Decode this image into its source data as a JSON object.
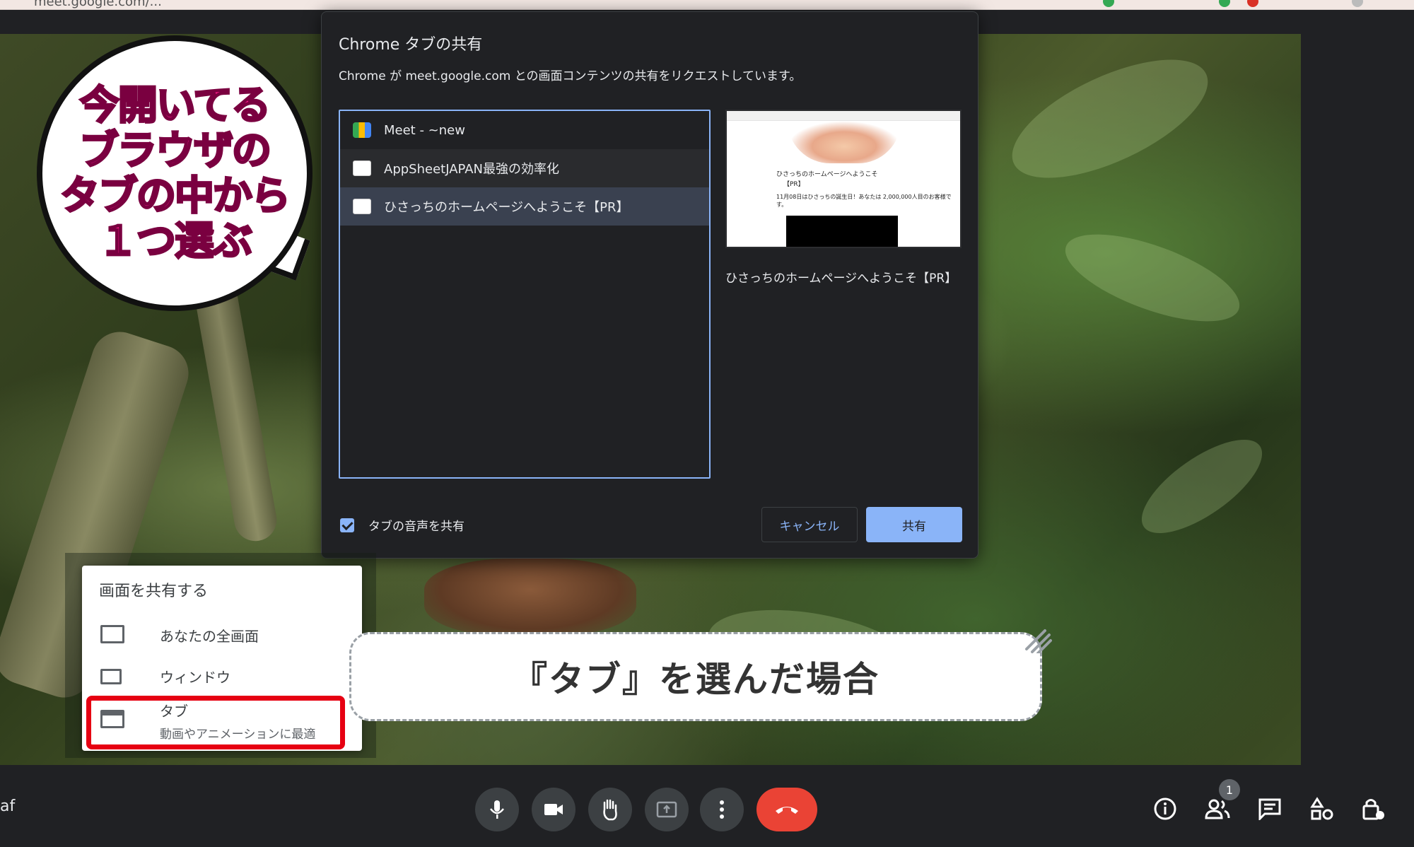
{
  "browser": {
    "url": "meet.google.com/..."
  },
  "bubble": {
    "line1": "今開いてる",
    "line2": "ブラウザの",
    "line3": "タブの中から",
    "line4": "１つ選ぶ"
  },
  "dialog": {
    "title": "Chrome タブの共有",
    "subtitle": "Chrome が meet.google.com との画面コンテンツの共有をリクエストしています。",
    "tabs": [
      {
        "label": "Meet - ~new",
        "icon": "meet-icon"
      },
      {
        "label": "AppSheetJAPAN最強の効率化",
        "icon": "page-favicon"
      },
      {
        "label": "ひさっちのホームページへようこそ【PR】",
        "icon": "page-favicon"
      }
    ],
    "selected_index": 2,
    "preview": {
      "line1": "ひさっちのホームページへようこそ",
      "line2": "【PR】",
      "line3": "11月08日はひさっちの誕生日！あなたは 2,000,000人目のお客様です。"
    },
    "preview_caption": "ひさっちのホームページへようこそ【PR】",
    "audio_checkbox_label": "タブの音声を共有",
    "audio_checked": true,
    "cancel_label": "キャンセル",
    "share_label": "共有"
  },
  "present_menu": {
    "title": "画面を共有する",
    "items": [
      {
        "label": "あなたの全画面",
        "icon": "monitor-icon"
      },
      {
        "label": "ウィンドウ",
        "icon": "window-icon"
      },
      {
        "label": "タブ",
        "sublabel": "動画やアニメーションに最適",
        "icon": "tab-icon"
      }
    ]
  },
  "caption": "『タブ』を選んだ場合",
  "bottom_bar": {
    "meeting_code": "af",
    "participants_count": "1",
    "colors": {
      "end_call": "#ea4335",
      "control_bg": "#3c4043",
      "accent": "#8ab4f8",
      "highlight": "#e60012"
    }
  }
}
